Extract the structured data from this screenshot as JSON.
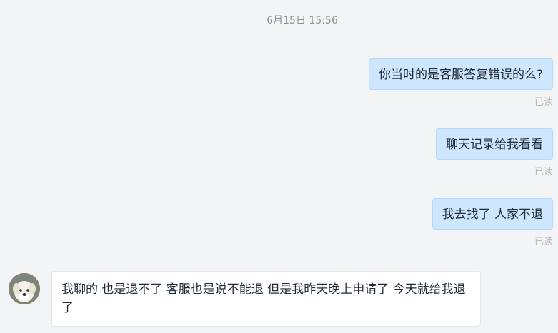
{
  "chat": {
    "timestamp": "6月15日 15:56",
    "messages": [
      {
        "direction": "outgoing",
        "text": "你当时的是客服答复错误的么?",
        "status": "已读"
      },
      {
        "direction": "outgoing",
        "text": "聊天记录给我看看",
        "status": "已读"
      },
      {
        "direction": "outgoing",
        "text": "我去找了 人家不退",
        "status": "已读"
      },
      {
        "direction": "incoming",
        "text": "我聊的 也是退不了  客服也是说不能退  但是我昨天晚上申请了 今天就给我退了",
        "avatar": "dog-avatar"
      }
    ]
  },
  "colors": {
    "background": "#f3f4f6",
    "outgoing_bubble": "#cfe6ff",
    "incoming_bubble": "#ffffff",
    "read_status": "#b5b8bd"
  }
}
